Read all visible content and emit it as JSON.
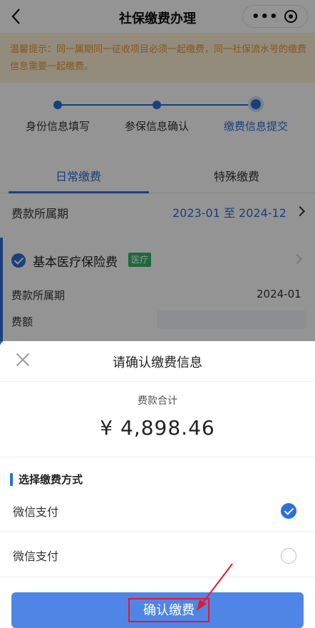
{
  "header": {
    "title": "社保缴费办理",
    "more_label": "•••",
    "back_icon": "back-chevron-icon",
    "close_icon": "miniapp-close-icon"
  },
  "tip": {
    "text": "温馨提示：同一属期同一征收项目必须一起缴费，同一社保流水号的缴费信息需要一起缴费。"
  },
  "steps": [
    {
      "label": "身份信息填写",
      "state": "done"
    },
    {
      "label": "参保信息确认",
      "state": "done"
    },
    {
      "label": "缴费信息提交",
      "state": "current"
    }
  ],
  "tabs": [
    {
      "label": "日常缴费",
      "active": true
    },
    {
      "label": "特殊缴费",
      "active": false
    }
  ],
  "period": {
    "label": "费款所属期",
    "value": "2023-01 至 2024-12"
  },
  "item": {
    "name": "基本医疗保险费",
    "tag": "医疗",
    "period_label": "费款所属期",
    "period_value": "2024-01",
    "amount_label": "费额",
    "checked": true
  },
  "sheet": {
    "title": "请确认缴费信息",
    "total_label": "费款合计",
    "total_value": "¥ 4,898.46",
    "method_title": "选择缴费方式",
    "methods": [
      {
        "label": "微信支付",
        "selected": true
      },
      {
        "label": "微信支付",
        "selected": false
      }
    ],
    "confirm_label": "确认缴费"
  },
  "colors": {
    "accent": "#2c6fd8",
    "button": "#4f86e6",
    "tip_text": "#e7963a",
    "tag": "#36b36a",
    "highlight": "#e1192d"
  }
}
